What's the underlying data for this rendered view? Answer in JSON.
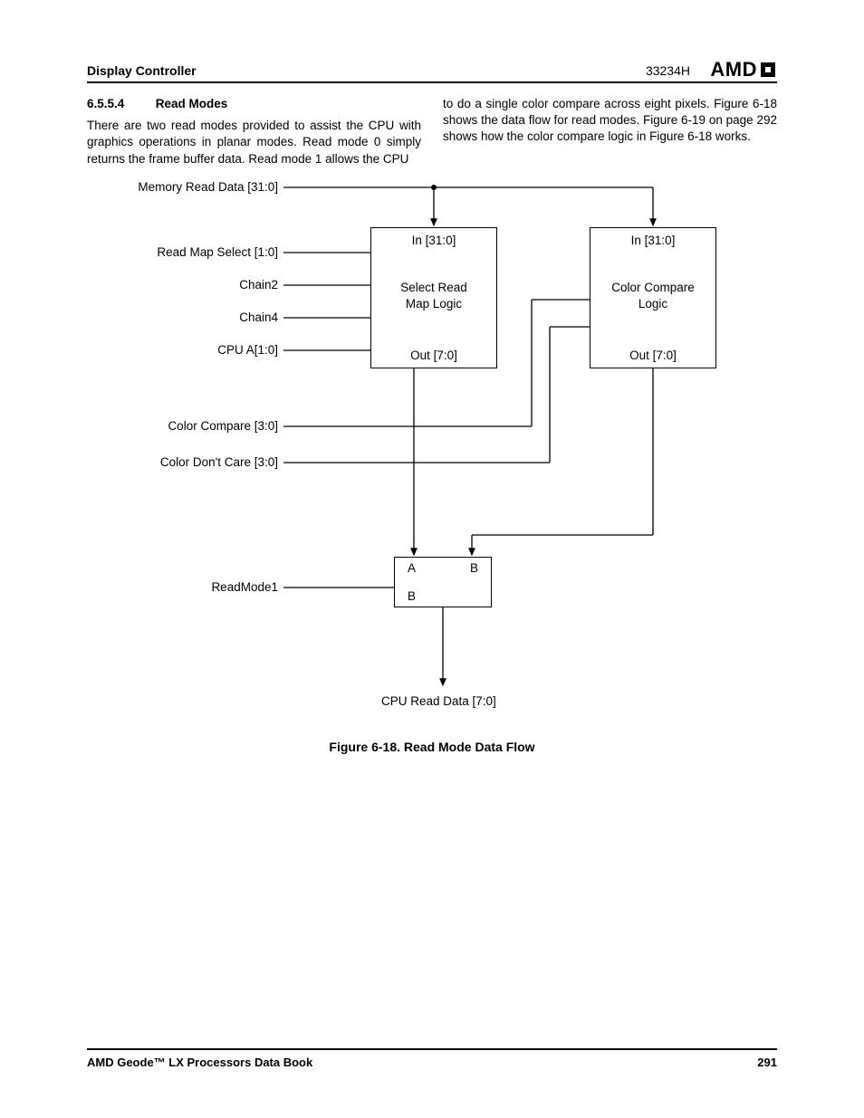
{
  "header": {
    "section": "Display Controller",
    "code": "33234H",
    "logo": "AMD"
  },
  "section": {
    "num": "6.5.5.4",
    "title": "Read Modes"
  },
  "para_left": "There are two read modes provided to assist the CPU with graphics operations in planar modes. Read mode 0 simply returns the frame buffer data. Read mode 1 allows the CPU",
  "para_right": "to do a single color compare across eight pixels. Figure 6-18 shows the data flow for read modes. Figure 6-19 on page 292 shows how the color compare logic in Figure 6-18 works.",
  "diagram": {
    "labels": {
      "mem_read": "Memory Read Data [31:0]",
      "rms": "Read Map Select [1:0]",
      "chain2": "Chain2",
      "chain4": "Chain4",
      "cpu_a": "CPU A[1:0]",
      "cc": "Color Compare [3:0]",
      "cdc": "Color Don't Care [3:0]",
      "readmode1": "ReadMode1",
      "cpu_read": "CPU Read Data [7:0]"
    },
    "box_left": {
      "in": "In [31:0]",
      "title1": "Select Read",
      "title2": "Map Logic",
      "out": "Out [7:0]"
    },
    "box_right": {
      "in": "In [31:0]",
      "title1": "Color Compare",
      "title2": "Logic",
      "out": "Out [7:0]"
    },
    "mux": {
      "a": "A",
      "b": "B",
      "sel": "B"
    }
  },
  "caption": "Figure 6-18.  Read Mode Data Flow",
  "footer": {
    "book": "AMD Geode™ LX Processors Data Book",
    "page": "291"
  }
}
